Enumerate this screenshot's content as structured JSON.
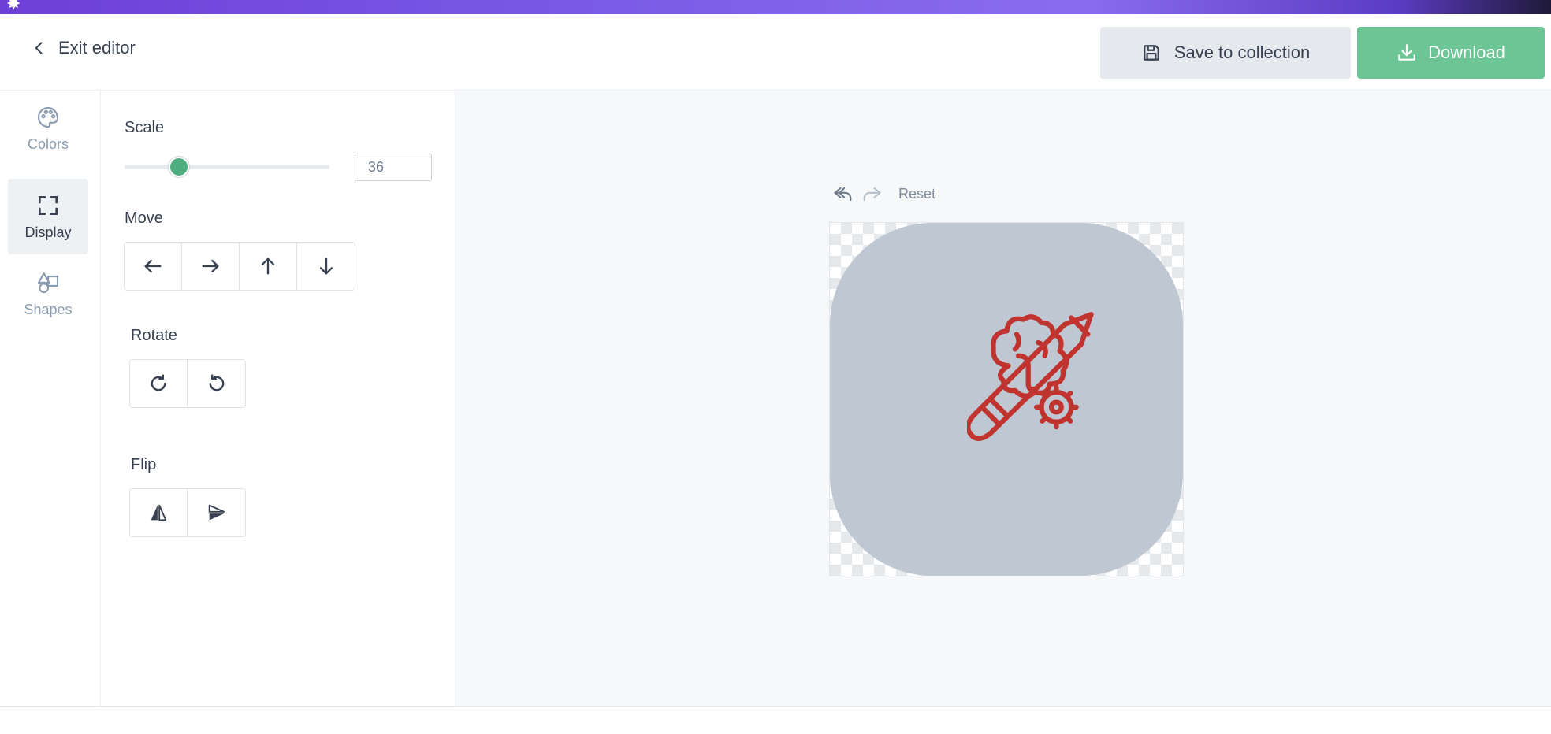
{
  "header": {
    "exit_label": "Exit editor",
    "save_label": "Save to collection",
    "download_label": "Download"
  },
  "sidebar": {
    "items": [
      {
        "label": "Colors",
        "icon": "palette-icon",
        "active": false
      },
      {
        "label": "Display",
        "icon": "fullscreen-frame-icon",
        "active": true
      },
      {
        "label": "Shapes",
        "icon": "shapes-icon",
        "active": false
      }
    ]
  },
  "panel": {
    "scale": {
      "label": "Scale",
      "value": "36"
    },
    "move": {
      "label": "Move"
    },
    "rotate": {
      "label": "Rotate"
    },
    "flip": {
      "label": "Flip"
    }
  },
  "canvas": {
    "reset_label": "Reset",
    "shape_color": "#bec7d2",
    "icon_color": "#c0332e",
    "icon": "brain-pencil-gear-icon"
  },
  "colors": {
    "accent": "#6dc495",
    "slider": "#4fad7f",
    "banner": "#7b5ce6"
  }
}
